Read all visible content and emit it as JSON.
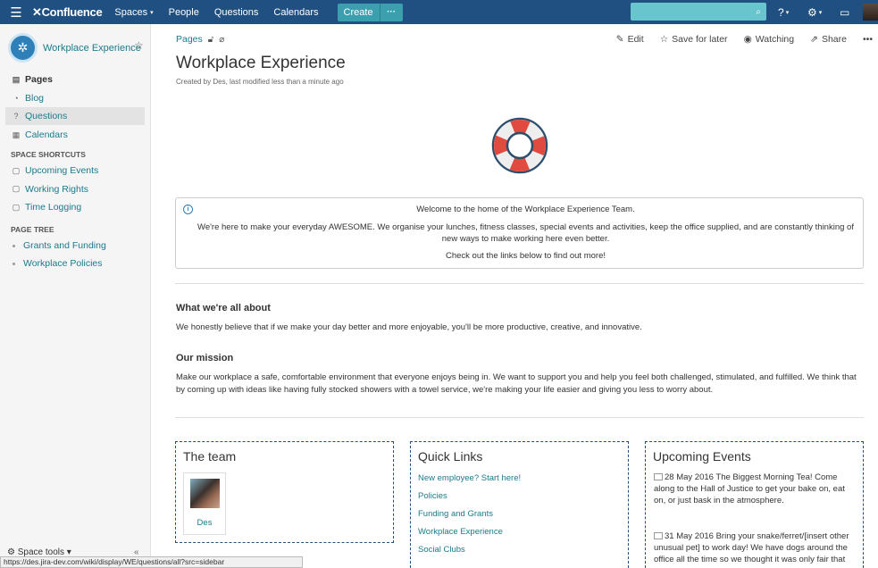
{
  "topnav": {
    "logo": "Confluence",
    "items": [
      "Spaces",
      "People",
      "Questions",
      "Calendars"
    ],
    "create": "Create",
    "create_more": "···"
  },
  "sidebar": {
    "space_name": "Workplace Experience",
    "nav": [
      {
        "label": "Pages",
        "icon": "pages-icon"
      },
      {
        "label": "Blog",
        "icon": "blog-icon"
      },
      {
        "label": "Questions",
        "icon": "questions-icon"
      },
      {
        "label": "Calendars",
        "icon": "calendar-icon"
      }
    ],
    "shortcuts_heading": "SPACE SHORTCUTS",
    "shortcuts": [
      "Upcoming Events",
      "Working Rights",
      "Time Logging"
    ],
    "tree_heading": "PAGE TREE",
    "tree": [
      "Grants and Funding",
      "Workplace Policies"
    ],
    "space_tools": "Space tools",
    "status_url": "https://des.jira-dev.com/wiki/display/WE/questions/all?src=sidebar"
  },
  "page": {
    "breadcrumb": "Pages",
    "actions": {
      "edit": "Edit",
      "save": "Save for later",
      "watching": "Watching",
      "share": "Share"
    },
    "title": "Workplace Experience",
    "byline": "Created by Des, last modified less than a minute ago",
    "info": {
      "line1": "Welcome to the home of the Workplace Experience Team.",
      "line2": "We're here to make your everyday AWESOME. We organise your lunches, fitness classes, special events and activities, keep the office supplied, and are constantly thinking of new ways to make working here even better.",
      "line3": "Check out the links below to find out more!"
    },
    "about_heading": "What we're all about",
    "about_text": "We honestly believe that if we make your day better and more enjoyable, you'll be more productive, creative, and innovative.",
    "mission_heading": "Our mission",
    "mission_text": "Make our workplace a safe, comfortable environment that everyone enjoys being in. We want to support you and help you feel both challenged, stimulated, and fulfilled. We think that by coming up with ideas like having fully stocked showers with a towel service, we're making your life easier and giving you less to worry about.",
    "team": {
      "title": "The team",
      "member": "Des"
    },
    "quick_links": {
      "title": "Quick Links",
      "links": [
        "New employee? Start here!",
        "Policies",
        "Funding and Grants",
        "Workplace Experience",
        "Social Clubs"
      ]
    },
    "events": {
      "title": "Upcoming Events",
      "items": [
        {
          "date": "28 May 2016",
          "text": "The Biggest Morning Tea! Come along to the Hall of Justice to get your bake on, eat on, or just bask in the atmosphere."
        },
        {
          "date": "31 May 2016",
          "text": "Bring your snake/ferret/[insert other unusual pet] to work day! We have dogs around the office all the time so we thought it was only fair that"
        }
      ]
    }
  },
  "colors": {
    "nav": "#205081",
    "link": "#1a7a8c",
    "create": "#3b9fae",
    "search": "#68c4cd"
  }
}
